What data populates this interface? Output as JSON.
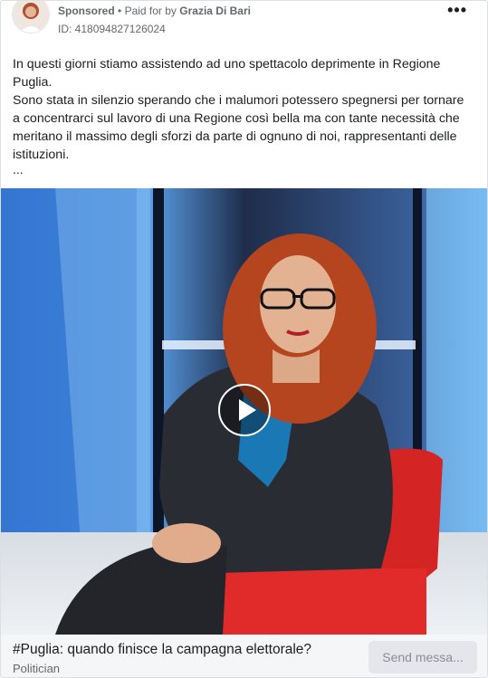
{
  "ad": {
    "sponsored_label": "Sponsored",
    "separator": "•",
    "paid_for_label": "Paid for by",
    "advertiser": "Grazia Di Bari",
    "id_text": "ID: 418094827126024",
    "more_icon": "•••"
  },
  "body": {
    "paragraph1": "In questi giorni stiamo assistendo ad uno spettacolo deprimente in Regione Puglia.",
    "paragraph2": "Sono stata in silenzio sperando che i malumori potessero spegnersi per tornare a concentrarci sul lavoro di una Regione così bella ma con tante necessità che meritano il massimo degli sforzi da parte di ognuno di noi, rappresentanti delle istituzioni.",
    "ellipsis": "..."
  },
  "media": {
    "type": "video",
    "play_icon": "play-icon"
  },
  "footer": {
    "headline": "#Puglia: quando finisce la campagna elettorale?",
    "subline": "Politician",
    "cta_label": "Send messa..."
  },
  "colors": {
    "background": "#ffffff",
    "cta_background": "#e4e6eb",
    "cta_text": "#8a8d91",
    "muted_text": "#65676b",
    "chair_red": "#d42424"
  }
}
